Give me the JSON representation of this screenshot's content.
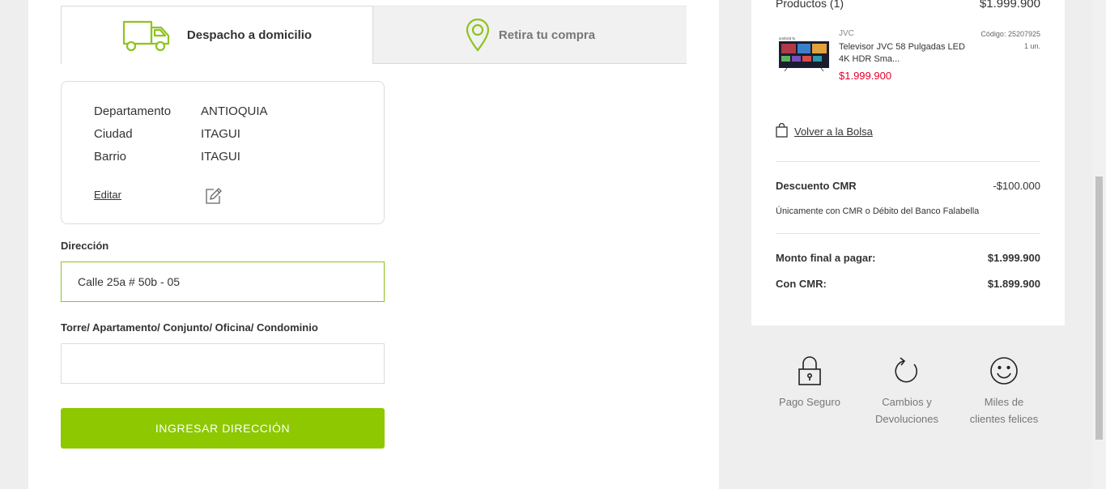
{
  "tabs": {
    "home_delivery": "Despacho a domicilio",
    "pickup": "Retira tu compra"
  },
  "address": {
    "rows": [
      {
        "label": "Departamento",
        "value": "ANTIOQUIA"
      },
      {
        "label": "Ciudad",
        "value": "ITAGUI"
      },
      {
        "label": "Barrio",
        "value": "ITAGUI"
      }
    ],
    "edit_label": "Editar"
  },
  "form": {
    "direccion_label": "Dirección",
    "direccion_value": "Calle 25a # 50b - 05",
    "torre_label": "Torre/ Apartamento/ Conjunto/ Oficina/ Condominio",
    "torre_value": "",
    "submit_label": "INGRESAR DIRECCIÓN"
  },
  "summary": {
    "products_label": "Productos (1)",
    "products_total": "$1.999.900",
    "product": {
      "brand": "JVC",
      "name": "Televisor JVC 58 Pulgadas LED 4K HDR Sma...",
      "price": "$1.999.900",
      "code": "Código: 25207925",
      "qty": "1 un."
    },
    "back_label": "Volver a la Bolsa",
    "discount_label": "Descuento CMR",
    "discount_value": "-$100.000",
    "discount_note": "Únicamente con CMR o Débito del Banco Falabella",
    "final_label": "Monto final a pagar:",
    "final_value": "$1.999.900",
    "cmr_label": "Con CMR:",
    "cmr_value": "$1.899.900"
  },
  "badges": [
    {
      "icon": "padlock-icon",
      "line1": "Pago Seguro",
      "line2": ""
    },
    {
      "icon": "refresh-arrow-icon",
      "line1": "Cambios y",
      "line2": "Devoluciones"
    },
    {
      "icon": "smiley-icon",
      "line1": "Miles de",
      "line2": "clientes felices"
    }
  ],
  "colors": {
    "accent_green": "#8dc800",
    "price_red": "#e4002b",
    "icon_green": "#8fc31f"
  }
}
